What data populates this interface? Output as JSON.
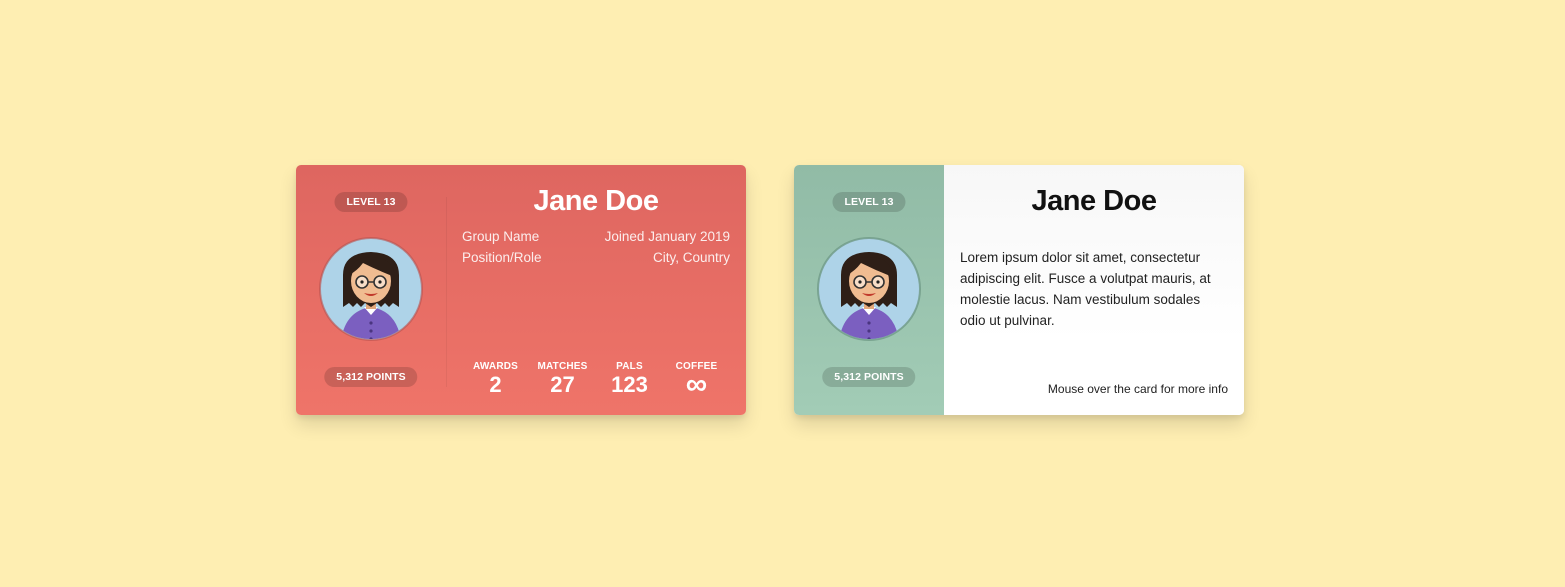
{
  "cards": [
    {
      "theme": "red",
      "accent_color": "#e76b64",
      "level_label": "LEVEL 13",
      "points_label": "5,312 POINTS",
      "name": "Jane Doe",
      "group": "Group Name",
      "joined": "Joined January 2019",
      "position": "Position/Role",
      "location": "City, Country",
      "stats": [
        {
          "label": "AWARDS",
          "value": "2"
        },
        {
          "label": "MATCHES",
          "value": "27"
        },
        {
          "label": "PALS",
          "value": "123"
        },
        {
          "label": "COFFEE",
          "value": "∞"
        }
      ]
    },
    {
      "theme": "green",
      "accent_color": "#9ac4ae",
      "level_label": "LEVEL 13",
      "points_label": "5,312 POINTS",
      "name": "Jane Doe",
      "description": "Lorem ipsum dolor sit amet, consectetur adipiscing elit. Fusce a volutpat mauris, at molestie lacus. Nam vestibulum sodales odio ut pulvinar.",
      "hint": "Mouse over the card for more info"
    }
  ],
  "page_background": "#feeeb2",
  "avatar_icon": "woman-with-glasses-avatar"
}
